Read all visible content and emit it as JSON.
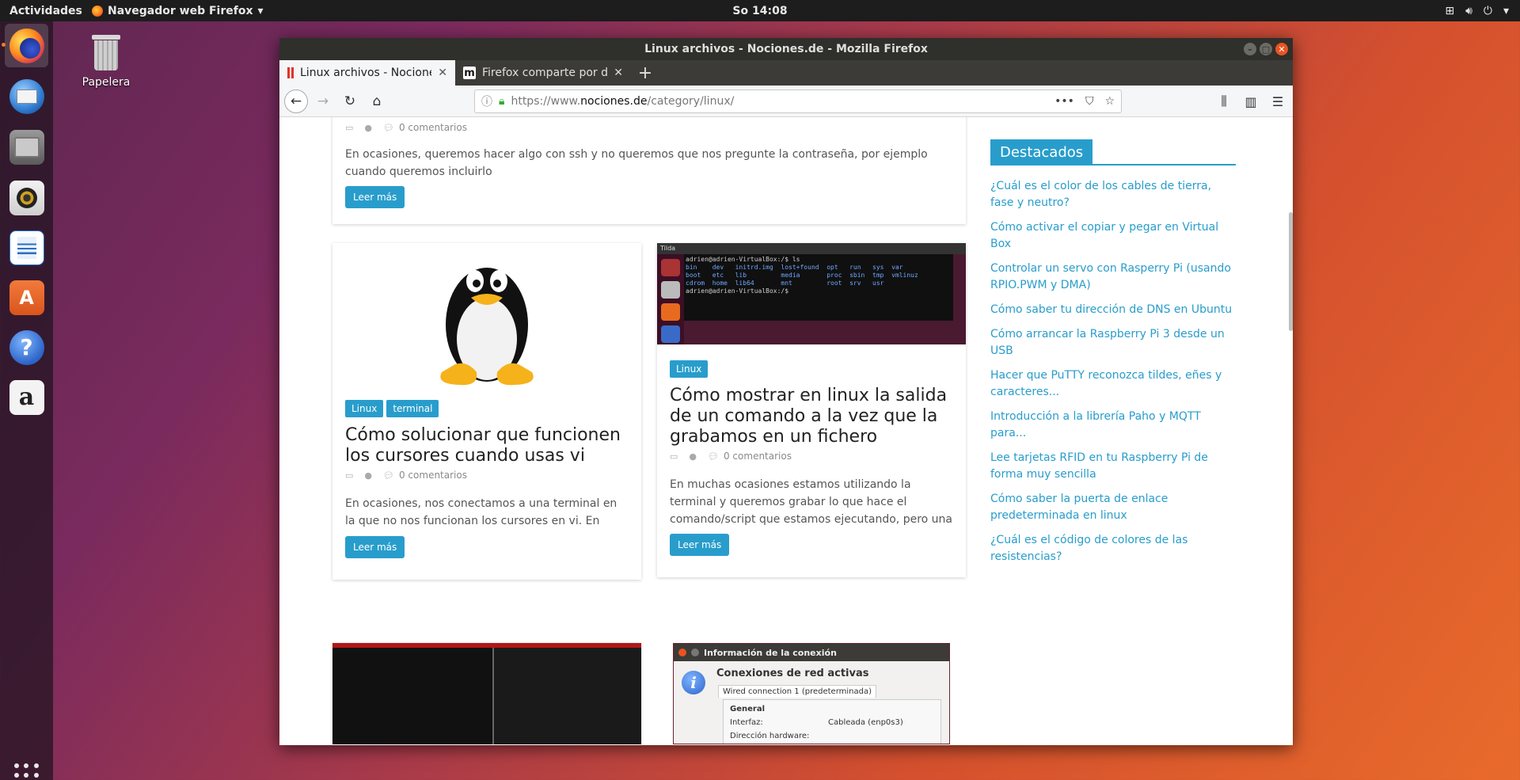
{
  "topbar": {
    "activities": "Actividades",
    "app_menu": "Navegador web Firefox",
    "clock": "So 14:08"
  },
  "desktop": {
    "trash_label": "Papelera"
  },
  "window": {
    "title": "Linux archivos - Nociones.de - Mozilla Firefox",
    "tabs": [
      {
        "label": "Linux archivos - Nociones.de",
        "active": true
      },
      {
        "label": "Firefox comparte por defecto",
        "active": false
      }
    ],
    "url": {
      "prefix": "https://www.",
      "host": "nociones.de",
      "path": "/category/linux/"
    }
  },
  "content": {
    "top_post": {
      "comments": "0 comentarios",
      "excerpt": "En ocasiones, queremos hacer algo con ssh y no queremos que nos pregunte la contraseña, por ejemplo cuando queremos incluirlo",
      "read_more": "Leer más"
    },
    "post_left": {
      "tags": [
        "Linux",
        "terminal"
      ],
      "title": "Cómo solucionar que funcionen los cursores cuando usas vi",
      "comments": "0 comentarios",
      "excerpt": "En ocasiones, nos conectamos a una terminal en la que no nos funcionan los cursores en vi. En lugar de",
      "read_more": "Leer más"
    },
    "post_right": {
      "terminal_title": "Tilda",
      "terminal_lines": [
        "adrien@adrien-VirtualBox:/$ ls",
        "bin    dev   initrd.img  lost+found  opt   run   sys  var",
        "boot   etc   lib         media       proc  sbin  tmp  vmlinuz",
        "cdrom  home  lib64       mnt         root  srv   usr",
        "adrien@adrien-VirtualBox:/$ "
      ],
      "tags": [
        "Linux"
      ],
      "title": "Cómo mostrar en linux la salida de un comando a la vez que la grabamos en un fichero",
      "comments": "0 comentarios",
      "excerpt": "En muchas ocasiones estamos utilizando la terminal y queremos grabar lo que hace el comando/script que estamos ejecutando, pero una",
      "read_more": "Leer más"
    },
    "bottom_right_dialog": {
      "title": "Información de la conexión",
      "heading": "Conexiones de red activas",
      "tab": "Wired connection 1 (predeterminada)",
      "section": "General",
      "rows": [
        {
          "k": "Interfaz:",
          "v": "Cableada (enp0s3)"
        },
        {
          "k": "Dirección hardware:",
          "v": ""
        }
      ]
    }
  },
  "sidebar": {
    "heading": "Destacados",
    "links": [
      "¿Cuál es el color de los cables de tierra, fase y neutro?",
      "Cómo activar el copiar y pegar en Virtual Box",
      "Controlar un servo con Rasperry Pi (usando RPIO.PWM y DMA)",
      "Cómo saber tu dirección de DNS en Ubuntu",
      "Cómo arrancar la Raspberry Pi 3 desde un USB",
      "Hacer que PuTTY reconozca tildes, eñes y caracteres...",
      "Introducción a la librería Paho y MQTT para...",
      "Lee tarjetas RFID en tu Raspberry Pi de forma muy sencilla",
      "Cómo saber la puerta de enlace predeterminada en linux",
      "¿Cuál es el código de colores de las resistencias?"
    ]
  },
  "icons": {
    "dock": [
      "firefox-icon",
      "thunderbird-icon",
      "files-icon",
      "rhythmbox-icon",
      "writer-icon",
      "software-icon",
      "help-icon",
      "amazon-icon",
      "apps-grid-icon"
    ]
  },
  "colors": {
    "accent": "#289dcc",
    "ubuntu_orange": "#e95420"
  }
}
